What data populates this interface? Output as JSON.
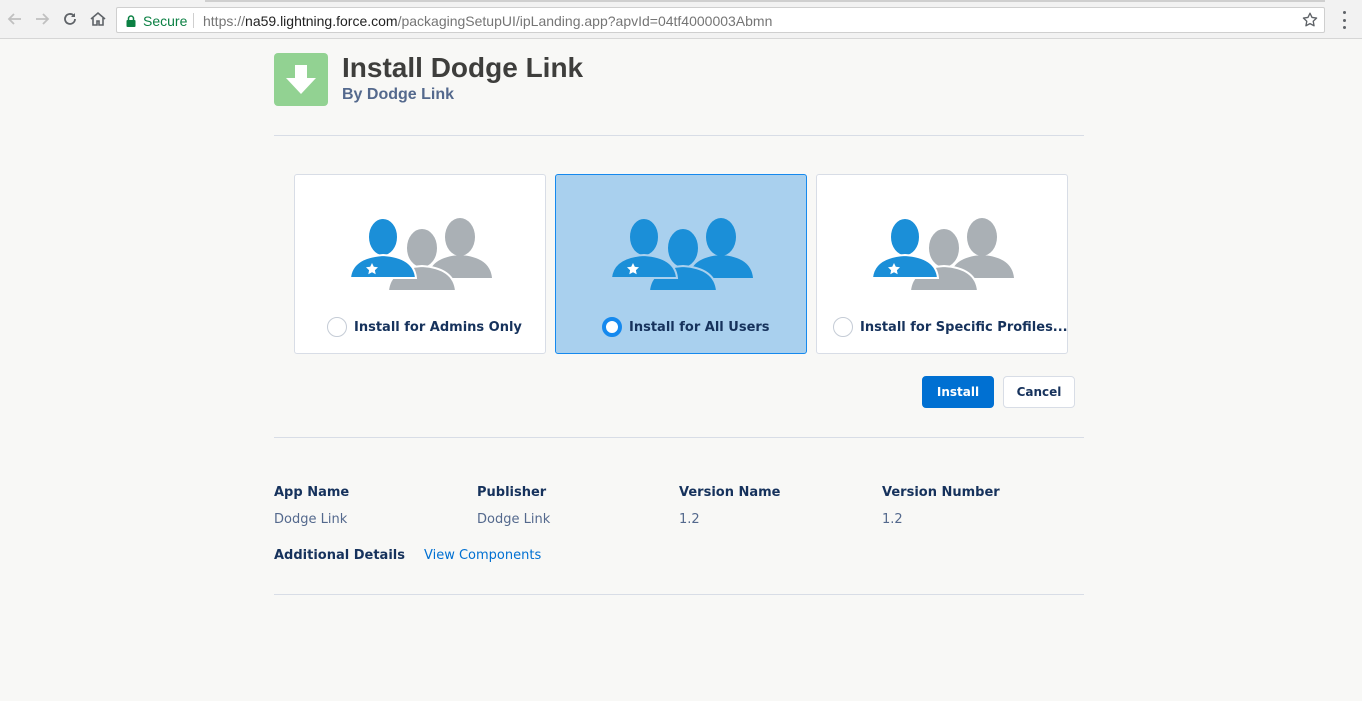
{
  "browser": {
    "secure_label": "Secure",
    "url_scheme": "https://",
    "url_host": "na59.lightning.force.com",
    "url_path": "/packagingSetupUI/ipLanding.app?apvId=04tf4000003Abmn",
    "icons": [
      "back-icon",
      "forward-icon",
      "reload-icon",
      "home-icon",
      "lock-icon",
      "star-icon",
      "menu-icon"
    ]
  },
  "header": {
    "title": "Install Dodge Link",
    "subtitle": "By Dodge Link",
    "icon": "download-arrow-icon",
    "icon_color": "#92d292"
  },
  "options": [
    {
      "label": "Install for Admins Only",
      "selected": false,
      "icon": "admins-people-icon"
    },
    {
      "label": "Install for All Users",
      "selected": true,
      "icon": "all-users-people-icon"
    },
    {
      "label": "Install for Specific Profiles...",
      "selected": false,
      "icon": "specific-profiles-people-icon"
    }
  ],
  "actions": {
    "install_label": "Install",
    "cancel_label": "Cancel",
    "primary_color": "#0070d2"
  },
  "details": {
    "headers": [
      "App Name",
      "Publisher",
      "Version Name",
      "Version Number"
    ],
    "values": [
      "Dodge Link",
      "Dodge Link",
      "1.2",
      "1.2"
    ],
    "additional_label": "Additional Details",
    "view_components_label": "View Components"
  },
  "colors": {
    "selected_card_bg": "#a9d0ee",
    "person_blue": "#1b8fd8",
    "person_gray": "#aab0b5"
  }
}
